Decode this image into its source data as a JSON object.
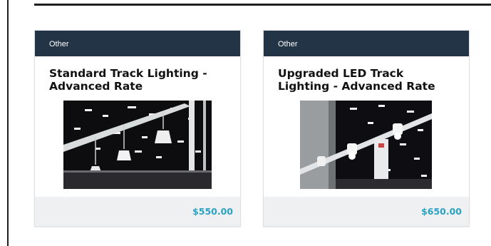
{
  "products": [
    {
      "category": "Other",
      "title": "Standard Track Lighting - Advanced Rate",
      "image_subject": "pendant-track-lights-photo",
      "price": "$550.00"
    },
    {
      "category": "Other",
      "title": "Upgraded LED Track Lighting - Advanced Rate",
      "image_subject": "led-track-spotlights-photo",
      "price": "$650.00"
    }
  ],
  "colors": {
    "header_bg": "#243447",
    "price": "#2ba2c5",
    "footer_bg": "#eef0f2"
  }
}
